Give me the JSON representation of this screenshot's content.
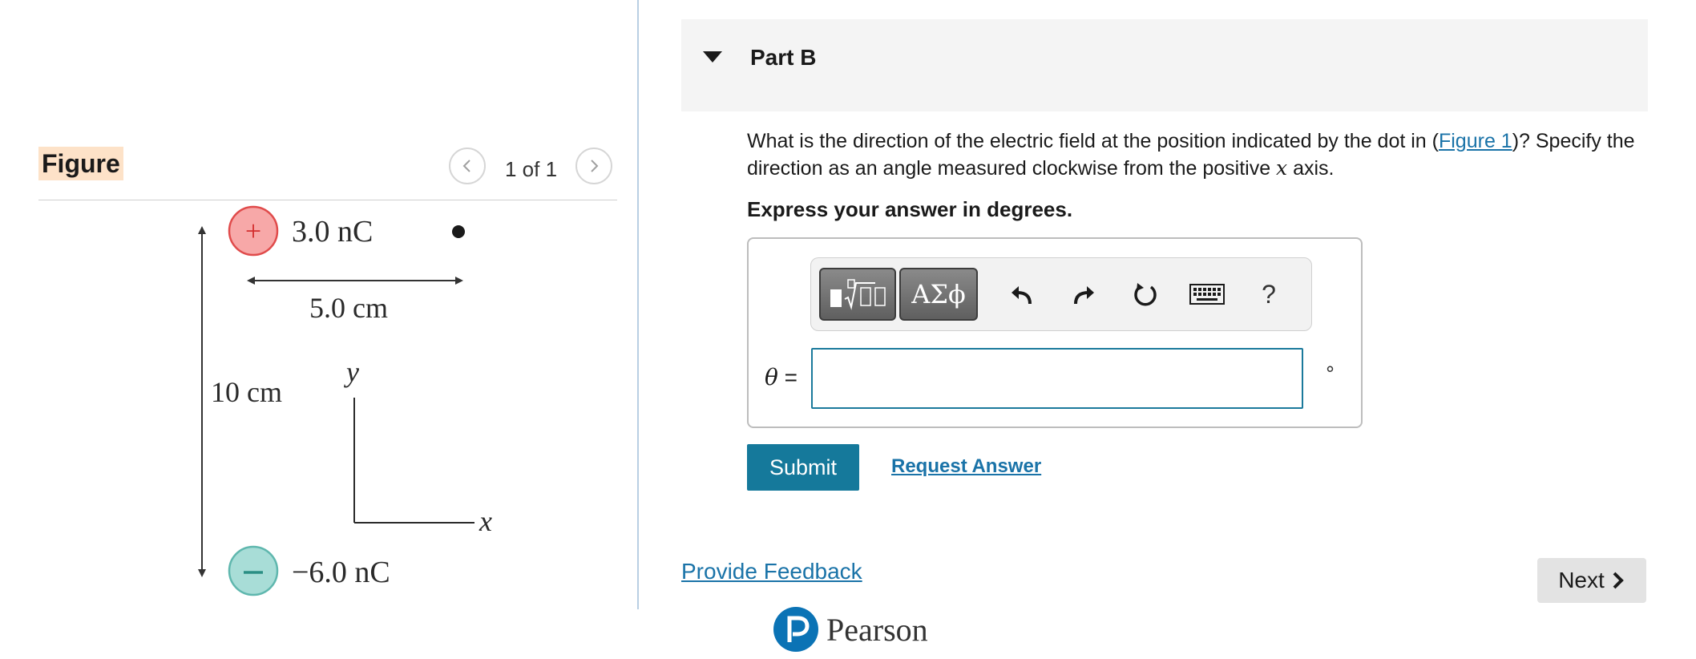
{
  "figure_panel": {
    "title": "Figure",
    "pager": "1 of 1",
    "prev_icon": "chevron-left-icon",
    "next_icon": "chevron-right-icon",
    "diagram": {
      "positive_charge_label": "3.0 nC",
      "positive_sign": "+",
      "negative_charge_label": "−6.0 nC",
      "negative_sign": "−",
      "horizontal_distance": "5.0 cm",
      "vertical_distance": "10 cm",
      "y_axis_label": "y",
      "x_axis_label": "x",
      "colors": {
        "positive_fill": "#f7a8a8",
        "positive_stroke": "#e04b4b",
        "negative_fill": "#a8ddd7",
        "negative_stroke": "#5fb7ae"
      }
    }
  },
  "part": {
    "title": "Part B",
    "question_pre": "What is the direction of the electric field at the position indicated by the dot in (",
    "figure_link": "Figure 1",
    "question_mid": ")? Specify the direction as an angle measured clockwise from the positive ",
    "question_var": "x",
    "question_post": " axis.",
    "instruction": "Express your answer in degrees."
  },
  "answer": {
    "toolbar": {
      "templates_button": "templates-icon",
      "greek_button": "ΑΣϕ",
      "undo": "undo-icon",
      "redo": "redo-icon",
      "reset": "reset-icon",
      "keyboard": "keyboard-icon",
      "help": "?"
    },
    "variable": "θ",
    "equals": "=",
    "value": "",
    "unit": "∘"
  },
  "actions": {
    "submit": "Submit",
    "request_answer": "Request Answer",
    "provide_feedback": "Provide Feedback",
    "next": "Next"
  },
  "footer": {
    "brand": "Pearson",
    "logo_letter": "P"
  },
  "colors": {
    "accent": "#15799b",
    "link": "#1a73a8",
    "figure_tag": "#fde2c8"
  }
}
